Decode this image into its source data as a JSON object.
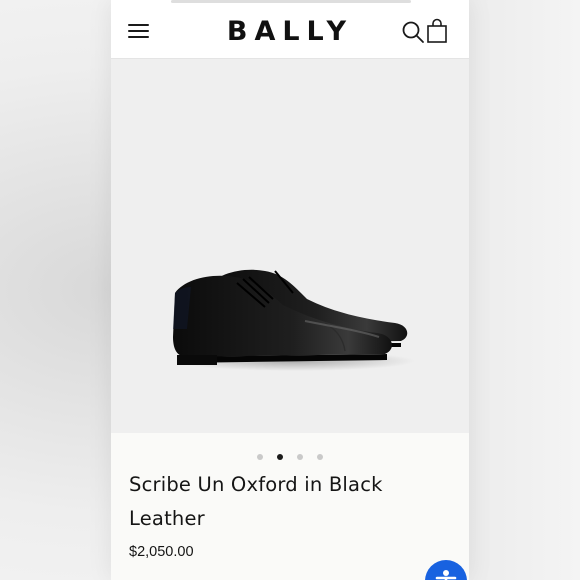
{
  "header": {
    "logo_text": "BALLY",
    "menu_icon": "hamburger-menu-icon",
    "search_icon": "search-icon",
    "bag_icon": "shopping-bag-icon"
  },
  "gallery": {
    "image_count": 4,
    "active_index": 1,
    "background_color": "#efefef"
  },
  "product": {
    "name": "Scribe Un Oxford in Black Leather",
    "price": "$2,050.00"
  },
  "accessibility": {
    "icon": "accessibility-icon",
    "color": "#1862e0"
  }
}
